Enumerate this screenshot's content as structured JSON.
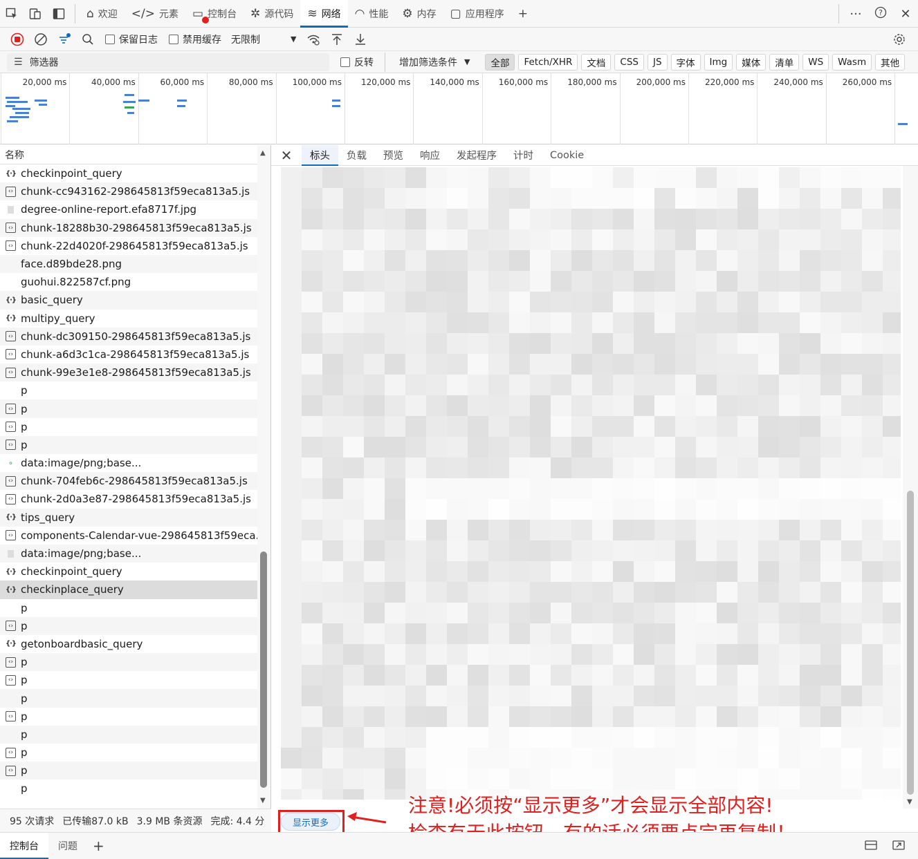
{
  "top_tabs": [
    {
      "label": "欢迎",
      "icon": "home-icon",
      "glyph": "⌂",
      "active": false
    },
    {
      "label": "元素",
      "icon": "code-icon",
      "glyph": "</>",
      "active": false
    },
    {
      "label": "控制台",
      "icon": "console-icon",
      "glyph": "▭",
      "active": false
    },
    {
      "label": "源代码",
      "icon": "bug-icon",
      "glyph": "✲",
      "active": false
    },
    {
      "label": "网络",
      "icon": "wifi-icon",
      "glyph": "≋",
      "active": true
    },
    {
      "label": "性能",
      "icon": "performance-icon",
      "glyph": "◠",
      "active": false
    },
    {
      "label": "内存",
      "icon": "memory-icon",
      "glyph": "⚙",
      "active": false
    },
    {
      "label": "应用程序",
      "icon": "application-icon",
      "glyph": "▢",
      "active": false
    }
  ],
  "top_right": {
    "more": "···",
    "help": "?",
    "close": "✕",
    "add": "+"
  },
  "toolbar": {
    "preserve_log": "保留日志",
    "disable_cache": "禁用缓存",
    "throttling": "无限制"
  },
  "filterbar": {
    "filter_placeholder": "筛选器",
    "invert": "反转",
    "add_condition": "增加筛选条件",
    "chips": [
      "全部",
      "Fetch/XHR",
      "文档",
      "CSS",
      "JS",
      "字体",
      "Img",
      "媒体",
      "清单",
      "WS",
      "Wasm",
      "其他"
    ],
    "active_chip": "全部"
  },
  "timeline": {
    "ticks": [
      "20,000 ms",
      "40,000 ms",
      "60,000 ms",
      "80,000 ms",
      "100,000 ms",
      "120,000 ms",
      "140,000 ms",
      "160,000 ms",
      "180,000 ms",
      "200,000 ms",
      "220,000 ms",
      "240,000 ms",
      "260,000 ms"
    ]
  },
  "list": {
    "header": "名称",
    "rows": [
      {
        "name": "checkinpoint_query",
        "type": "xhr"
      },
      {
        "name": "chunk-cc943162-298645813f59eca813a5.js",
        "type": "js"
      },
      {
        "name": "degree-online-report.efa8717f.jpg",
        "type": "img"
      },
      {
        "name": "chunk-18288b30-298645813f59eca813a5.js",
        "type": "js"
      },
      {
        "name": "chunk-22d4020f-298645813f59eca813a5.js",
        "type": "js"
      },
      {
        "name": "face.d89bde28.png",
        "type": "none"
      },
      {
        "name": "guohui.822587cf.png",
        "type": "none"
      },
      {
        "name": "basic_query",
        "type": "xhr"
      },
      {
        "name": "multipy_query",
        "type": "xhr"
      },
      {
        "name": "chunk-dc309150-298645813f59eca813a5.js",
        "type": "js"
      },
      {
        "name": "chunk-a6d3c1ca-298645813f59eca813a5.js",
        "type": "js"
      },
      {
        "name": "chunk-99e3e1e8-298645813f59eca813a5.js",
        "type": "js"
      },
      {
        "name": "p",
        "type": "none"
      },
      {
        "name": "p",
        "type": "js"
      },
      {
        "name": "p",
        "type": "js"
      },
      {
        "name": "p",
        "type": "js"
      },
      {
        "name": "data:image/png;base...",
        "type": "dot"
      },
      {
        "name": "chunk-704feb6c-298645813f59eca813a5.js",
        "type": "js"
      },
      {
        "name": "chunk-2d0a3e87-298645813f59eca813a5.js",
        "type": "js"
      },
      {
        "name": "tips_query",
        "type": "xhr"
      },
      {
        "name": "components-Calendar-vue-298645813f59eca...",
        "type": "js"
      },
      {
        "name": "data:image/png;base...",
        "type": "img"
      },
      {
        "name": "checkinpoint_query",
        "type": "xhr"
      },
      {
        "name": "checkinplace_query",
        "type": "xhr",
        "selected": true
      },
      {
        "name": "p",
        "type": "none"
      },
      {
        "name": "p",
        "type": "js"
      },
      {
        "name": "getonboardbasic_query",
        "type": "xhr"
      },
      {
        "name": "p",
        "type": "js"
      },
      {
        "name": "p",
        "type": "js"
      },
      {
        "name": "p",
        "type": "none"
      },
      {
        "name": "p",
        "type": "js"
      },
      {
        "name": "p",
        "type": "none"
      },
      {
        "name": "p",
        "type": "js"
      },
      {
        "name": "p",
        "type": "js"
      },
      {
        "name": "p",
        "type": "none"
      }
    ]
  },
  "detail": {
    "tabs": [
      "标头",
      "负载",
      "预览",
      "响应",
      "发起程序",
      "计时",
      "Cookie"
    ],
    "active_tab": "标头",
    "show_more": "显示更多"
  },
  "status": {
    "requests": "95 次请求",
    "transferred": "已传输87.0 kB",
    "resources": "3.9 MB 条资源",
    "finish": "完成: 4.4 分"
  },
  "annotation": {
    "line1": "注意!必须按“显示更多”才会显示全部内容!",
    "line2": "检查有无此按钮，有的话必须要点完再复制！",
    "color": "#e0201f"
  },
  "drawer": {
    "tabs": [
      "控制台",
      "问题"
    ],
    "active_tab": "控制台"
  },
  "colors": {
    "accent": "#0f6cbd",
    "annotation_red": "#e0201f"
  }
}
